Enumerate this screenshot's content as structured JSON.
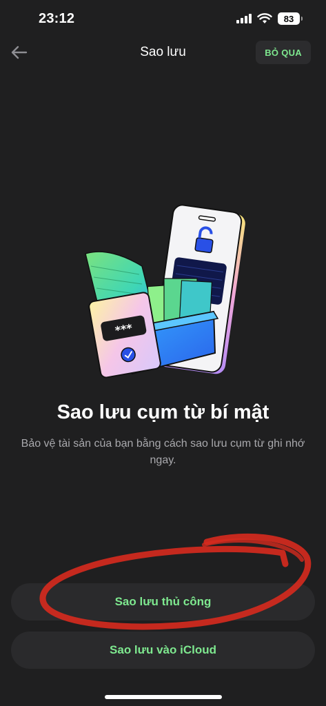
{
  "status_bar": {
    "time": "23:12",
    "battery": "83",
    "icons": [
      "signal-icon",
      "wifi-icon",
      "battery-icon"
    ]
  },
  "nav": {
    "back_icon": "arrow-left-icon",
    "title": "Sao lưu",
    "skip_label": "BỎ QUA"
  },
  "content": {
    "illustration": "phone-folder-backup-illustration",
    "headline": "Sao lưu cụm từ bí mật",
    "subtitle": "Bảo vệ tài sản của bạn bằng cách sao lưu cụm từ ghi nhớ ngay.",
    "card_mask": "***"
  },
  "actions": {
    "manual_label": "Sao lưu thủ công",
    "icloud_label": "Sao lưu vào iCloud"
  },
  "colors": {
    "background": "#1f1f20",
    "accent_green": "#7ee88f",
    "button_bg": "#2a2a2c",
    "annotation_red": "#d42a1e"
  }
}
